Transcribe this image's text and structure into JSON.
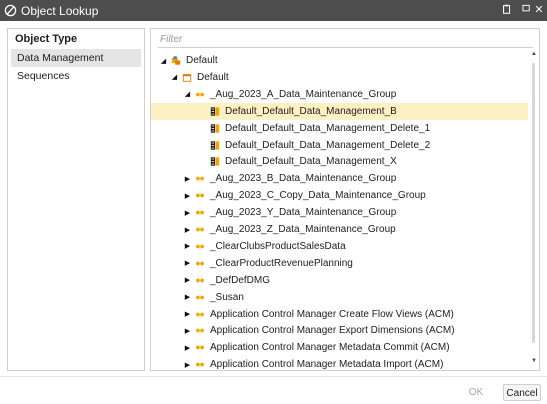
{
  "window": {
    "title": "Object Lookup",
    "app_icon": "circle-slash-icon",
    "buttons": [
      "restore-icon",
      "maximize-icon",
      "close-icon"
    ]
  },
  "left": {
    "header": "Object Type",
    "items": [
      "Data Management Sequences"
    ]
  },
  "filter": {
    "placeholder": "Filter",
    "value": ""
  },
  "tree": [
    {
      "label": "Default",
      "level": 0,
      "icon": "folder-multi-icon",
      "expanded": true
    },
    {
      "label": "Default",
      "level": 1,
      "icon": "folder-outline-icon",
      "expanded": true
    },
    {
      "label": "_Aug_2023_A_Data_Maintenance_Group",
      "level": 2,
      "icon": "group-dots-icon",
      "expanded": true
    },
    {
      "label": "Default_Default_Data_Management_B",
      "level": 3,
      "icon": "sequence-icon",
      "selected": true
    },
    {
      "label": "Default_Default_Data_Management_Delete_1",
      "level": 3,
      "icon": "sequence-icon"
    },
    {
      "label": "Default_Default_Data_Management_Delete_2",
      "level": 3,
      "icon": "sequence-icon"
    },
    {
      "label": "Default_Default_Data_Management_X",
      "level": 3,
      "icon": "sequence-icon"
    },
    {
      "label": "_Aug_2023_B_Data_Maintenance_Group",
      "level": 2,
      "icon": "group-dots-icon",
      "expanded": false
    },
    {
      "label": "_Aug_2023_C_Copy_Data_Maintenance_Group",
      "level": 2,
      "icon": "group-dots-icon",
      "expanded": false
    },
    {
      "label": "_Aug_2023_Y_Data_Maintenance_Group",
      "level": 2,
      "icon": "group-dots-icon",
      "expanded": false
    },
    {
      "label": "_Aug_2023_Z_Data_Maintenance_Group",
      "level": 2,
      "icon": "group-dots-icon",
      "expanded": false
    },
    {
      "label": "_ClearClubsProductSalesData",
      "level": 2,
      "icon": "group-dots-icon",
      "expanded": false
    },
    {
      "label": "_ClearProductRevenuePlanning",
      "level": 2,
      "icon": "group-dots-icon",
      "expanded": false
    },
    {
      "label": "_DefDefDMG",
      "level": 2,
      "icon": "group-dots-icon",
      "expanded": false
    },
    {
      "label": "_Susan",
      "level": 2,
      "icon": "group-dots-icon",
      "expanded": false
    },
    {
      "label": "Application Control Manager Create Flow Views (ACM)",
      "level": 2,
      "icon": "group-dots-icon",
      "expanded": false
    },
    {
      "label": "Application Control Manager Export Dimensions (ACM)",
      "level": 2,
      "icon": "group-dots-icon",
      "expanded": false
    },
    {
      "label": "Application Control Manager Metadata Commit (ACM)",
      "level": 2,
      "icon": "group-dots-icon",
      "expanded": false
    },
    {
      "label": "Application Control Manager Metadata Import (ACM)",
      "level": 2,
      "icon": "group-dots-icon",
      "expanded": false
    }
  ],
  "footer": {
    "ok": "OK",
    "cancel": "Cancel"
  },
  "colors": {
    "titlebar": "#4d4d4d",
    "accent": "#f5a300",
    "selected": "#fdf1c3"
  }
}
